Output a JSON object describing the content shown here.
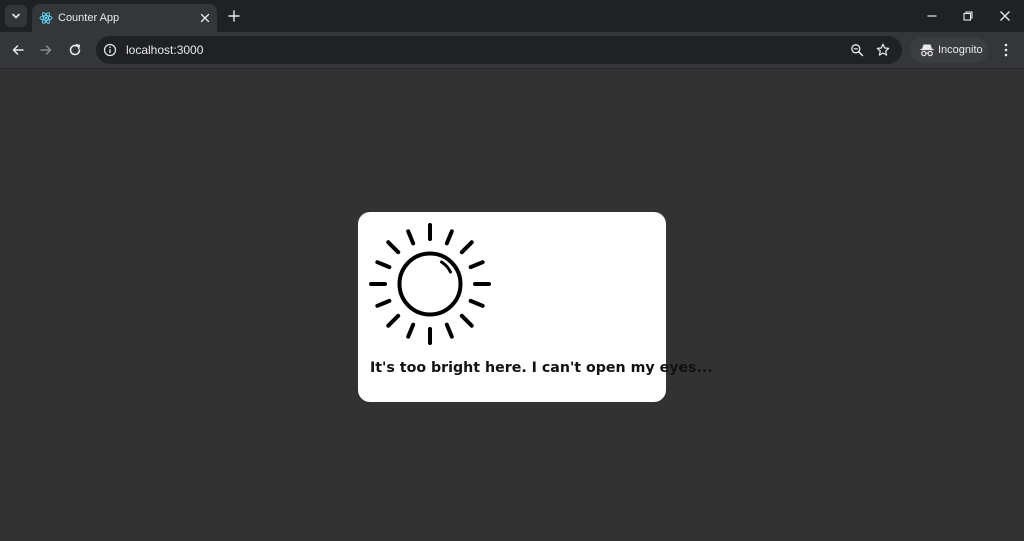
{
  "browser": {
    "tab": {
      "title": "Counter App",
      "favicon": "react-atom-icon"
    },
    "address": {
      "url": "localhost:3000"
    },
    "profile": {
      "label": "Incognito"
    },
    "icons": {
      "tab_search": "chevron-down-icon",
      "close_tab": "close-icon",
      "new_tab": "plus-icon",
      "back": "arrow-left-icon",
      "forward": "arrow-right-icon",
      "reload": "reload-icon",
      "site_info": "info-icon",
      "zoom": "zoom-icon",
      "bookmark": "star-icon",
      "menu": "kebab-menu-icon"
    }
  },
  "page": {
    "illustration": "sun-icon",
    "message": "It's too bright here. I can't open my eyes..."
  },
  "colors": {
    "tabstrip": "#202124",
    "toolbar": "#35363a",
    "page_background": "#323232",
    "card_background": "#ffffff",
    "react_accent": "#61dafb"
  }
}
